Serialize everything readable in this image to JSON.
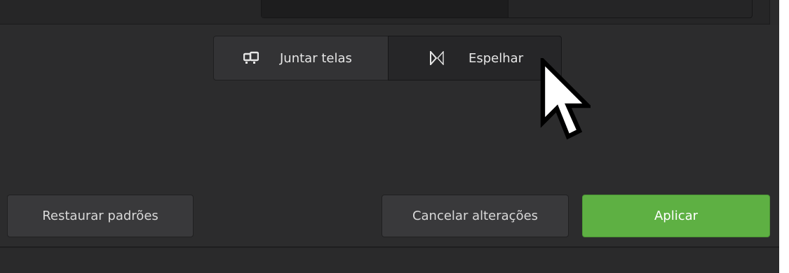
{
  "mode_selector": {
    "join_label": "Juntar telas",
    "join_icon": "join-displays-icon",
    "mirror_label": "Espelhar",
    "mirror_icon": "mirror-displays-icon"
  },
  "actions": {
    "restore_label": "Restaurar padrões",
    "cancel_label": "Cancelar alterações",
    "apply_label": "Aplicar"
  },
  "colors": {
    "background": "#2b2b2c",
    "button": "#39393b",
    "accent": "#5eb043"
  },
  "cursor_icon": "arrow-pointer-icon"
}
